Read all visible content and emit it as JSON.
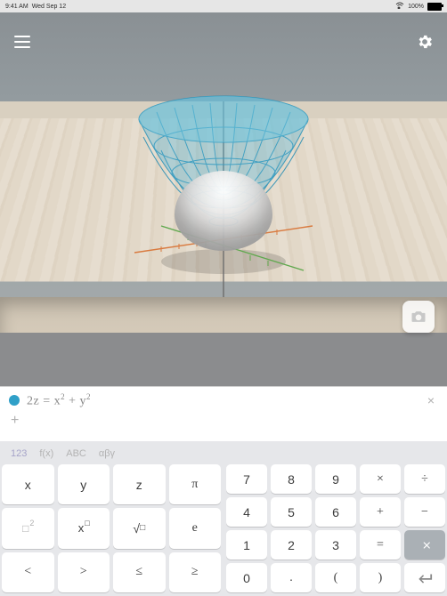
{
  "status_bar": {
    "time": "9:41 AM",
    "date": "Wed Sep 12",
    "battery_text": "100%"
  },
  "equation": {
    "display": "2z = x² + y²",
    "html": "2z = x<sup>2</sup> + y<sup>2</sup>"
  },
  "icons": {
    "menu": "menu-icon",
    "settings": "gear-icon",
    "camera": "camera-icon",
    "close": "×",
    "plus": "+"
  },
  "keyboard": {
    "tabs": [
      "123",
      "f(x)",
      "ABC",
      "αβγ"
    ],
    "active_tab": 0,
    "left_pad": [
      [
        "x",
        "y",
        "z",
        "π"
      ],
      [
        "□²",
        "x□",
        "√□",
        "e"
      ],
      [
        "<",
        ">",
        "≤",
        "≥"
      ]
    ],
    "right_pad": [
      [
        "7",
        "8",
        "9",
        "×",
        "÷"
      ],
      [
        "4",
        "5",
        "6",
        "+",
        "−"
      ],
      [
        "1",
        "2",
        "3",
        "=",
        "⌫"
      ],
      [
        "0",
        ".",
        "(",
        ")",
        "↵"
      ]
    ]
  },
  "graph": {
    "surface": "paraboloid",
    "equation": "2z = x^2 + y^2",
    "color": "#4ab3d6",
    "axis_colors": {
      "x": "#d97a3f",
      "y": "#5fa84d",
      "z": "#6c6c6c"
    }
  }
}
